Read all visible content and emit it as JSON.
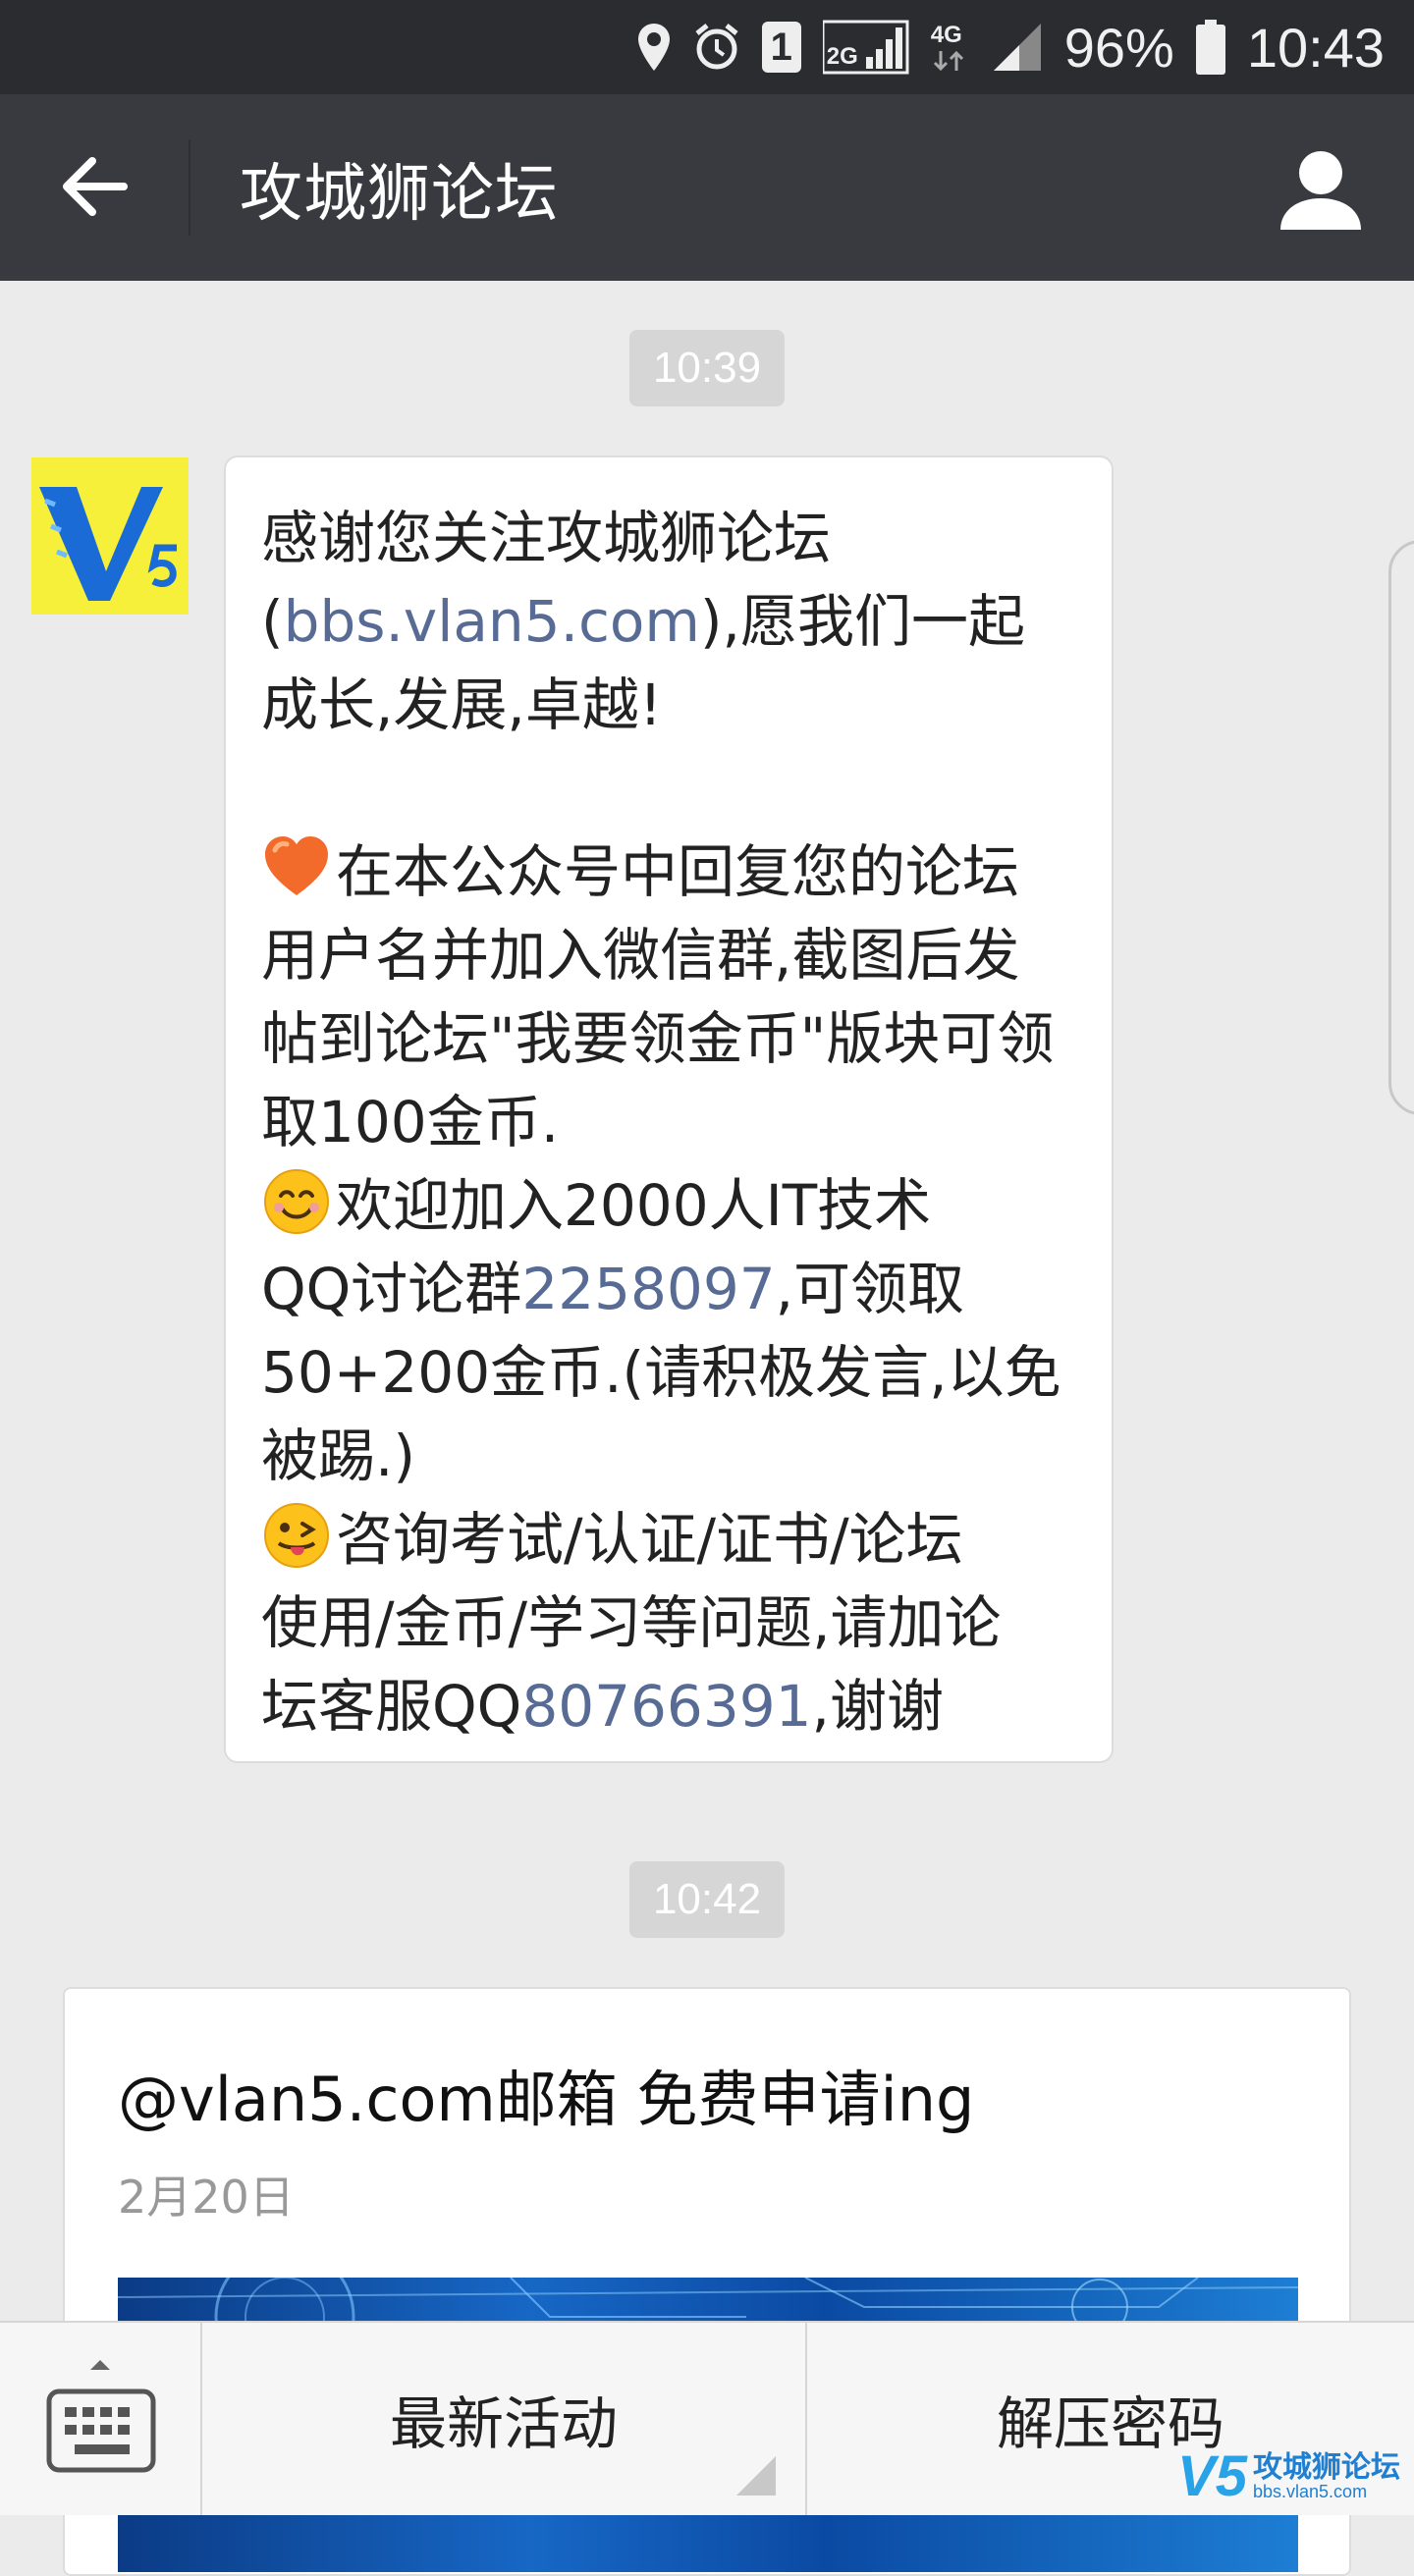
{
  "status_bar": {
    "sim_slot": "1",
    "network_2g": "2G",
    "network_4g": "4G",
    "battery": "96%",
    "time": "10:43"
  },
  "header": {
    "title": "攻城狮论坛"
  },
  "messages": {
    "timestamp_1": "10:39",
    "welcome": {
      "l1": "感谢您关注攻城狮论坛",
      "l2_open": "(",
      "l2_link": "bbs.vlan5.com",
      "l2_rest": "),愿我们一起",
      "l3": "成长,发展,卓越!",
      "l5": "在本公众号中回复您的论坛",
      "l6": "用户名并加入微信群,截图后发",
      "l7": "帖到论坛\"我要领金币\"版块可领",
      "l8": "取100金币.",
      "l9": "欢迎加入2000人IT技术",
      "l10_pre": "QQ讨论群",
      "l10_link": "2258097",
      "l10_post": ",可领取",
      "l11": "50+200金币.(请积极发言,以免",
      "l12": "被踢.)",
      "l13": "咨询考试/认证/证书/论坛",
      "l14": "使用/金币/学习等问题,请加论",
      "l15_pre": "坛客服QQ",
      "l15_link": "80766391",
      "l15_post": ",谢谢"
    },
    "timestamp_2": "10:42",
    "article": {
      "title": "@vlan5.com邮箱  免费申请ing",
      "date": "2月20日"
    }
  },
  "bottom_menu": {
    "item_1": "最新活动",
    "item_2": "解压密码"
  },
  "watermark": {
    "logo": "V5",
    "name": "攻城狮论坛",
    "url": "bbs.vlan5.com"
  },
  "colors": {
    "link": "#576b95",
    "header_bg": "#393a3f",
    "status_bg": "#2a2c30",
    "chat_bg": "#ebebeb"
  },
  "icons": [
    "location-icon",
    "alarm-icon",
    "signal-icon",
    "battery-icon",
    "back-arrow-icon",
    "profile-icon",
    "keyboard-icon",
    "heart-emoji-icon",
    "smile-emoji-icon",
    "wink-tongue-emoji-icon"
  ]
}
